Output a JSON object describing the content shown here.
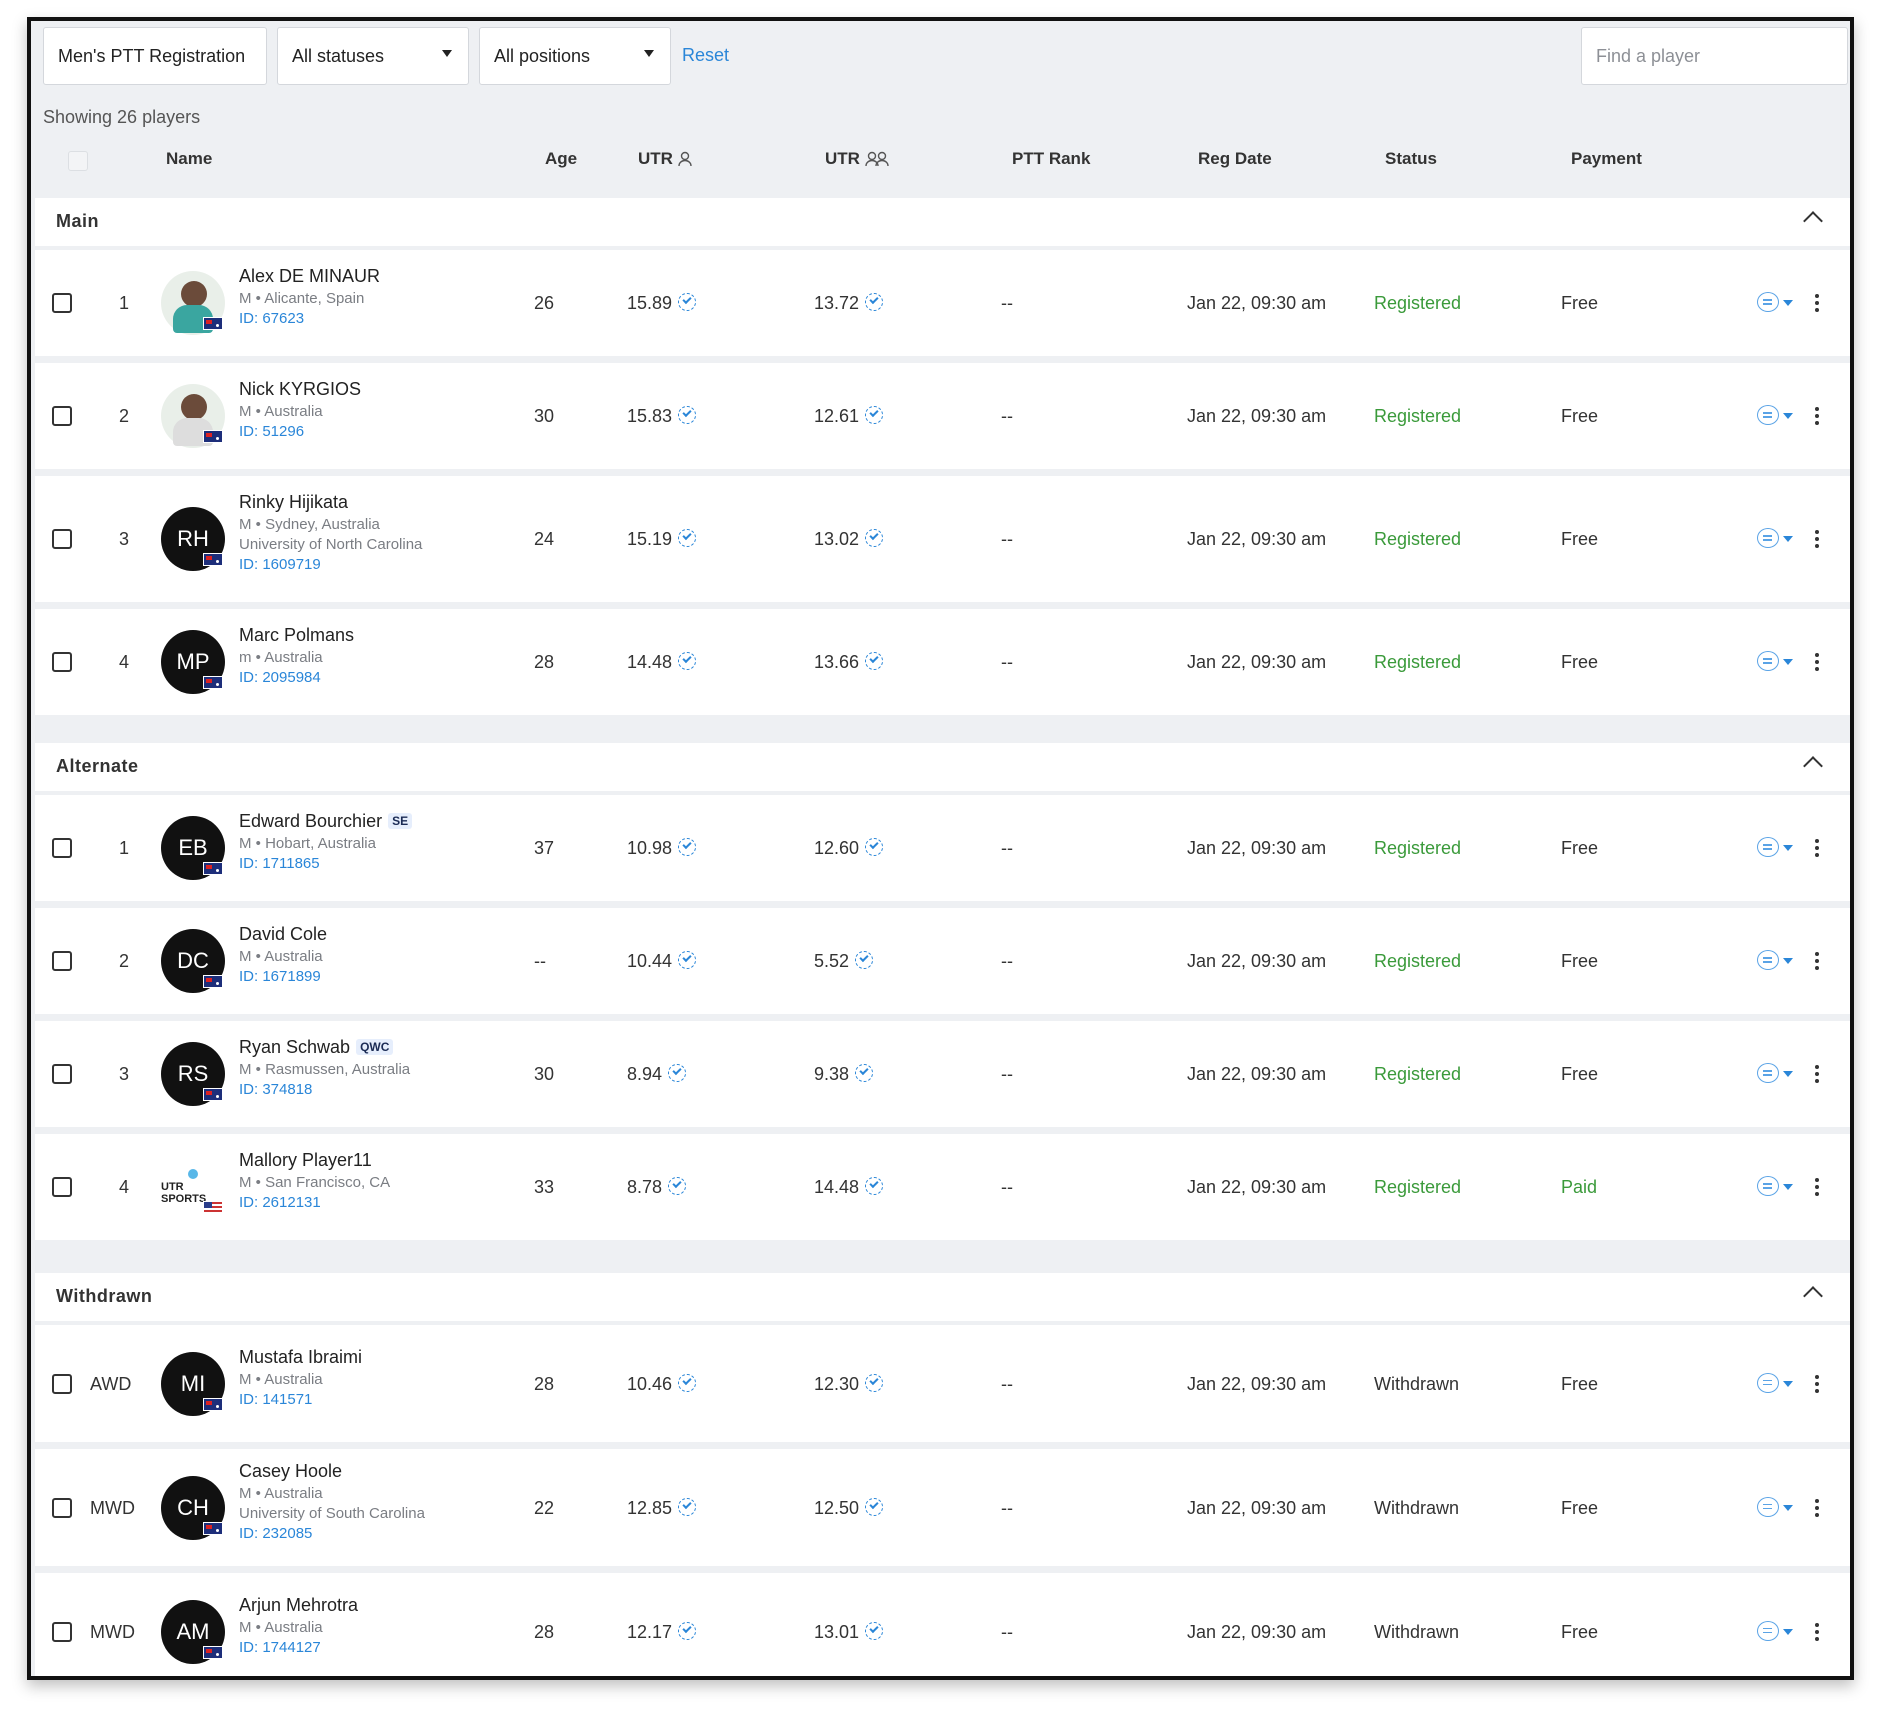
{
  "toolbar": {
    "event_label": "Men's PTT Registration",
    "status_filter": "All statuses",
    "position_filter": "All positions",
    "reset_label": "Reset",
    "search_placeholder": "Find a player"
  },
  "showing_text": "Showing 26 players",
  "columns": {
    "name": "Name",
    "age": "Age",
    "utr_singles": "UTR",
    "utr_doubles": "UTR",
    "ptt_rank": "PTT Rank",
    "reg_date": "Reg Date",
    "status": "Status",
    "payment": "Payment"
  },
  "sections": [
    {
      "title": "Main",
      "rows": [
        {
          "pos": "1",
          "avatar": "photo",
          "initials": "",
          "name": "Alex DE MINAUR",
          "tag": "",
          "meta": "M • Alicante, Spain",
          "school": "",
          "id": "ID: 67623",
          "flag": "AU",
          "age": "26",
          "utr_s": "15.89",
          "utr_d": "13.72",
          "rank": "--",
          "reg": "Jan 22, 09:30 am",
          "status": "Registered",
          "payment": "Free"
        },
        {
          "pos": "2",
          "avatar": "photo-white",
          "initials": "",
          "name": "Nick KYRGIOS",
          "tag": "",
          "meta": "M • Australia",
          "school": "",
          "id": "ID: 51296",
          "flag": "AU",
          "age": "30",
          "utr_s": "15.83",
          "utr_d": "12.61",
          "rank": "--",
          "reg": "Jan 22, 09:30 am",
          "status": "Registered",
          "payment": "Free"
        },
        {
          "pos": "3",
          "avatar": "initials",
          "initials": "RH",
          "name": "Rinky Hijikata",
          "tag": "",
          "meta": "M • Sydney, Australia",
          "school": "University of North Carolina",
          "id": "ID: 1609719",
          "flag": "AU",
          "age": "24",
          "utr_s": "15.19",
          "utr_d": "13.02",
          "rank": "--",
          "reg": "Jan 22, 09:30 am",
          "status": "Registered",
          "payment": "Free"
        },
        {
          "pos": "4",
          "avatar": "initials",
          "initials": "MP",
          "name": "Marc Polmans",
          "tag": "",
          "meta": "m • Australia",
          "school": "",
          "id": "ID: 2095984",
          "flag": "AU",
          "age": "28",
          "utr_s": "14.48",
          "utr_d": "13.66",
          "rank": "--",
          "reg": "Jan 22, 09:30 am",
          "status": "Registered",
          "payment": "Free"
        }
      ]
    },
    {
      "title": "Alternate",
      "rows": [
        {
          "pos": "1",
          "avatar": "initials",
          "initials": "EB",
          "name": "Edward Bourchier",
          "tag": "SE",
          "meta": "M • Hobart, Australia",
          "school": "",
          "id": "ID: 1711865",
          "flag": "AU",
          "age": "37",
          "utr_s": "10.98",
          "utr_d": "12.60",
          "rank": "--",
          "reg": "Jan 22, 09:30 am",
          "status": "Registered",
          "payment": "Free"
        },
        {
          "pos": "2",
          "avatar": "initials",
          "initials": "DC",
          "name": "David Cole",
          "tag": "",
          "meta": "M • Australia",
          "school": "",
          "id": "ID: 1671899",
          "flag": "AU",
          "age": "--",
          "utr_s": "10.44",
          "utr_d": "5.52",
          "rank": "--",
          "reg": "Jan 22, 09:30 am",
          "status": "Registered",
          "payment": "Free"
        },
        {
          "pos": "3",
          "avatar": "initials",
          "initials": "RS",
          "name": "Ryan Schwab",
          "tag": "QWC",
          "meta": "M • Rasmussen, Australia",
          "school": "",
          "id": "ID: 374818",
          "flag": "AU",
          "age": "30",
          "utr_s": "8.94",
          "utr_d": "9.38",
          "rank": "--",
          "reg": "Jan 22, 09:30 am",
          "status": "Registered",
          "payment": "Free"
        },
        {
          "pos": "4",
          "avatar": "utr",
          "initials": "UTR SPORTS",
          "name": "Mallory Player11",
          "tag": "",
          "meta": "M • San Francisco, CA",
          "school": "",
          "id": "ID: 2612131",
          "flag": "US",
          "age": "33",
          "utr_s": "8.78",
          "utr_d": "14.48",
          "rank": "--",
          "reg": "Jan 22, 09:30 am",
          "status": "Registered",
          "payment": "Paid"
        }
      ]
    },
    {
      "title": "Withdrawn",
      "rows": [
        {
          "pos": "AWD",
          "avatar": "initials",
          "initials": "MI",
          "name": "Mustafa Ibraimi",
          "tag": "",
          "meta": "M • Australia",
          "school": "",
          "id": "ID: 141571",
          "flag": "AU",
          "age": "28",
          "utr_s": "10.46",
          "utr_d": "12.30",
          "rank": "--",
          "reg": "Jan 22, 09:30 am",
          "status": "Withdrawn",
          "payment": "Free"
        },
        {
          "pos": "MWD",
          "avatar": "initials",
          "initials": "CH",
          "name": "Casey Hoole",
          "tag": "",
          "meta": "M • Australia",
          "school": "University of South Carolina",
          "id": "ID: 232085",
          "flag": "AU",
          "age": "22",
          "utr_s": "12.85",
          "utr_d": "12.50",
          "rank": "--",
          "reg": "Jan 22, 09:30 am",
          "status": "Withdrawn",
          "payment": "Free"
        },
        {
          "pos": "MWD",
          "avatar": "initials",
          "initials": "AM",
          "name": "Arjun Mehrotra",
          "tag": "",
          "meta": "M • Australia",
          "school": "",
          "id": "ID: 1744127",
          "flag": "AU",
          "age": "28",
          "utr_s": "12.17",
          "utr_d": "13.01",
          "rank": "--",
          "reg": "Jan 22, 09:30 am",
          "status": "Withdrawn",
          "payment": "Free"
        }
      ]
    }
  ],
  "colors": {
    "accent": "#2a86d8",
    "registered": "#3a9a3a",
    "paid": "#3a9a3a",
    "page_bg": "#eef0f3"
  }
}
